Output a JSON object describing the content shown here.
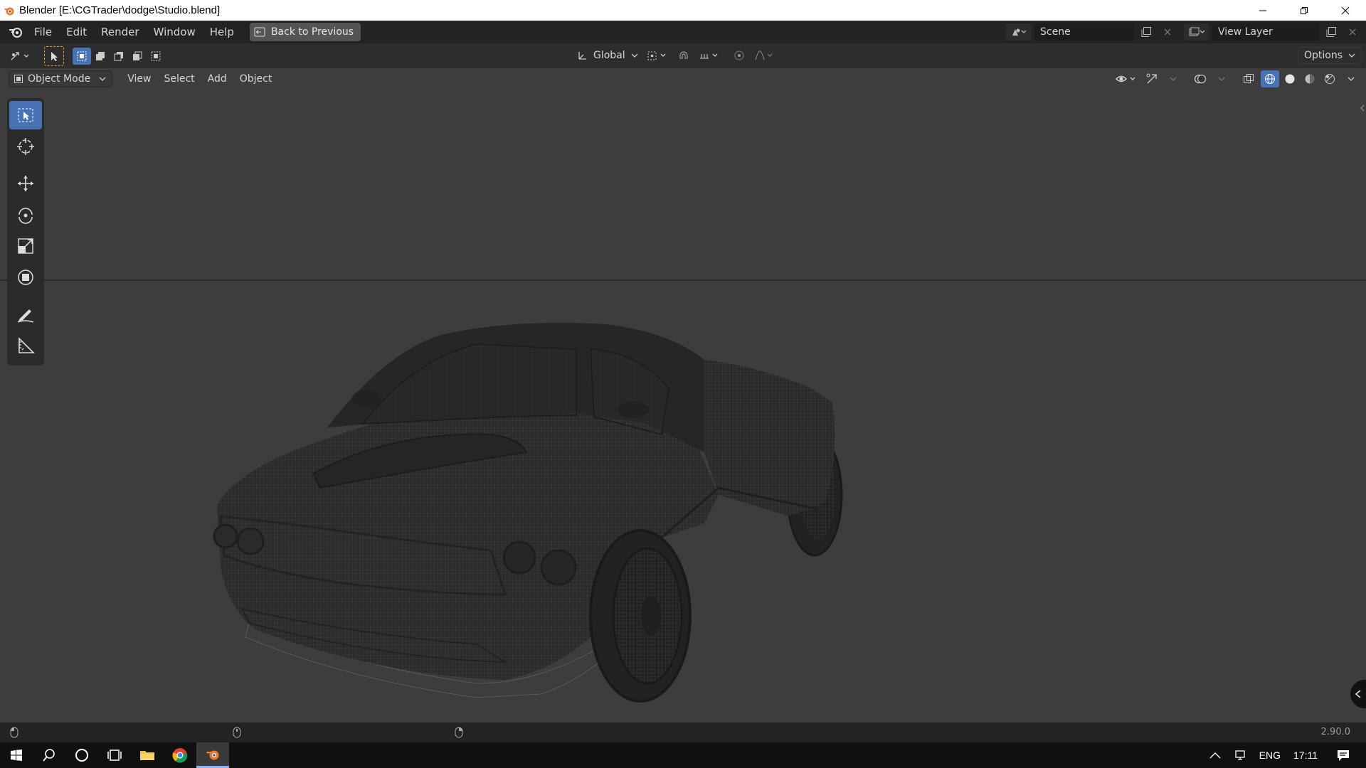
{
  "window": {
    "title": "Blender [E:\\CGTrader\\dodge\\Studio.blend]"
  },
  "topbar": {
    "menus": [
      "File",
      "Edit",
      "Render",
      "Window",
      "Help"
    ],
    "back_button": "Back to Previous",
    "scene_name": "Scene",
    "view_layer": "View Layer"
  },
  "tool_header": {
    "transform_orientation": "Global",
    "options_label": "Options"
  },
  "view_header": {
    "mode": "Object Mode",
    "menus": [
      "View",
      "Select",
      "Add",
      "Object"
    ]
  },
  "toolbar": {
    "tools": [
      "select-box",
      "cursor",
      "move",
      "rotate",
      "scale",
      "transform",
      "annotate",
      "measure"
    ],
    "active_tool": "select-box"
  },
  "statusbar": {
    "version": "2.90.0"
  },
  "taskbar": {
    "language": "ENG",
    "time": "17:11"
  },
  "colors": {
    "accent": "#4772b3",
    "viewport_bg": "#3d3d3d",
    "header_bg": "#232323"
  }
}
